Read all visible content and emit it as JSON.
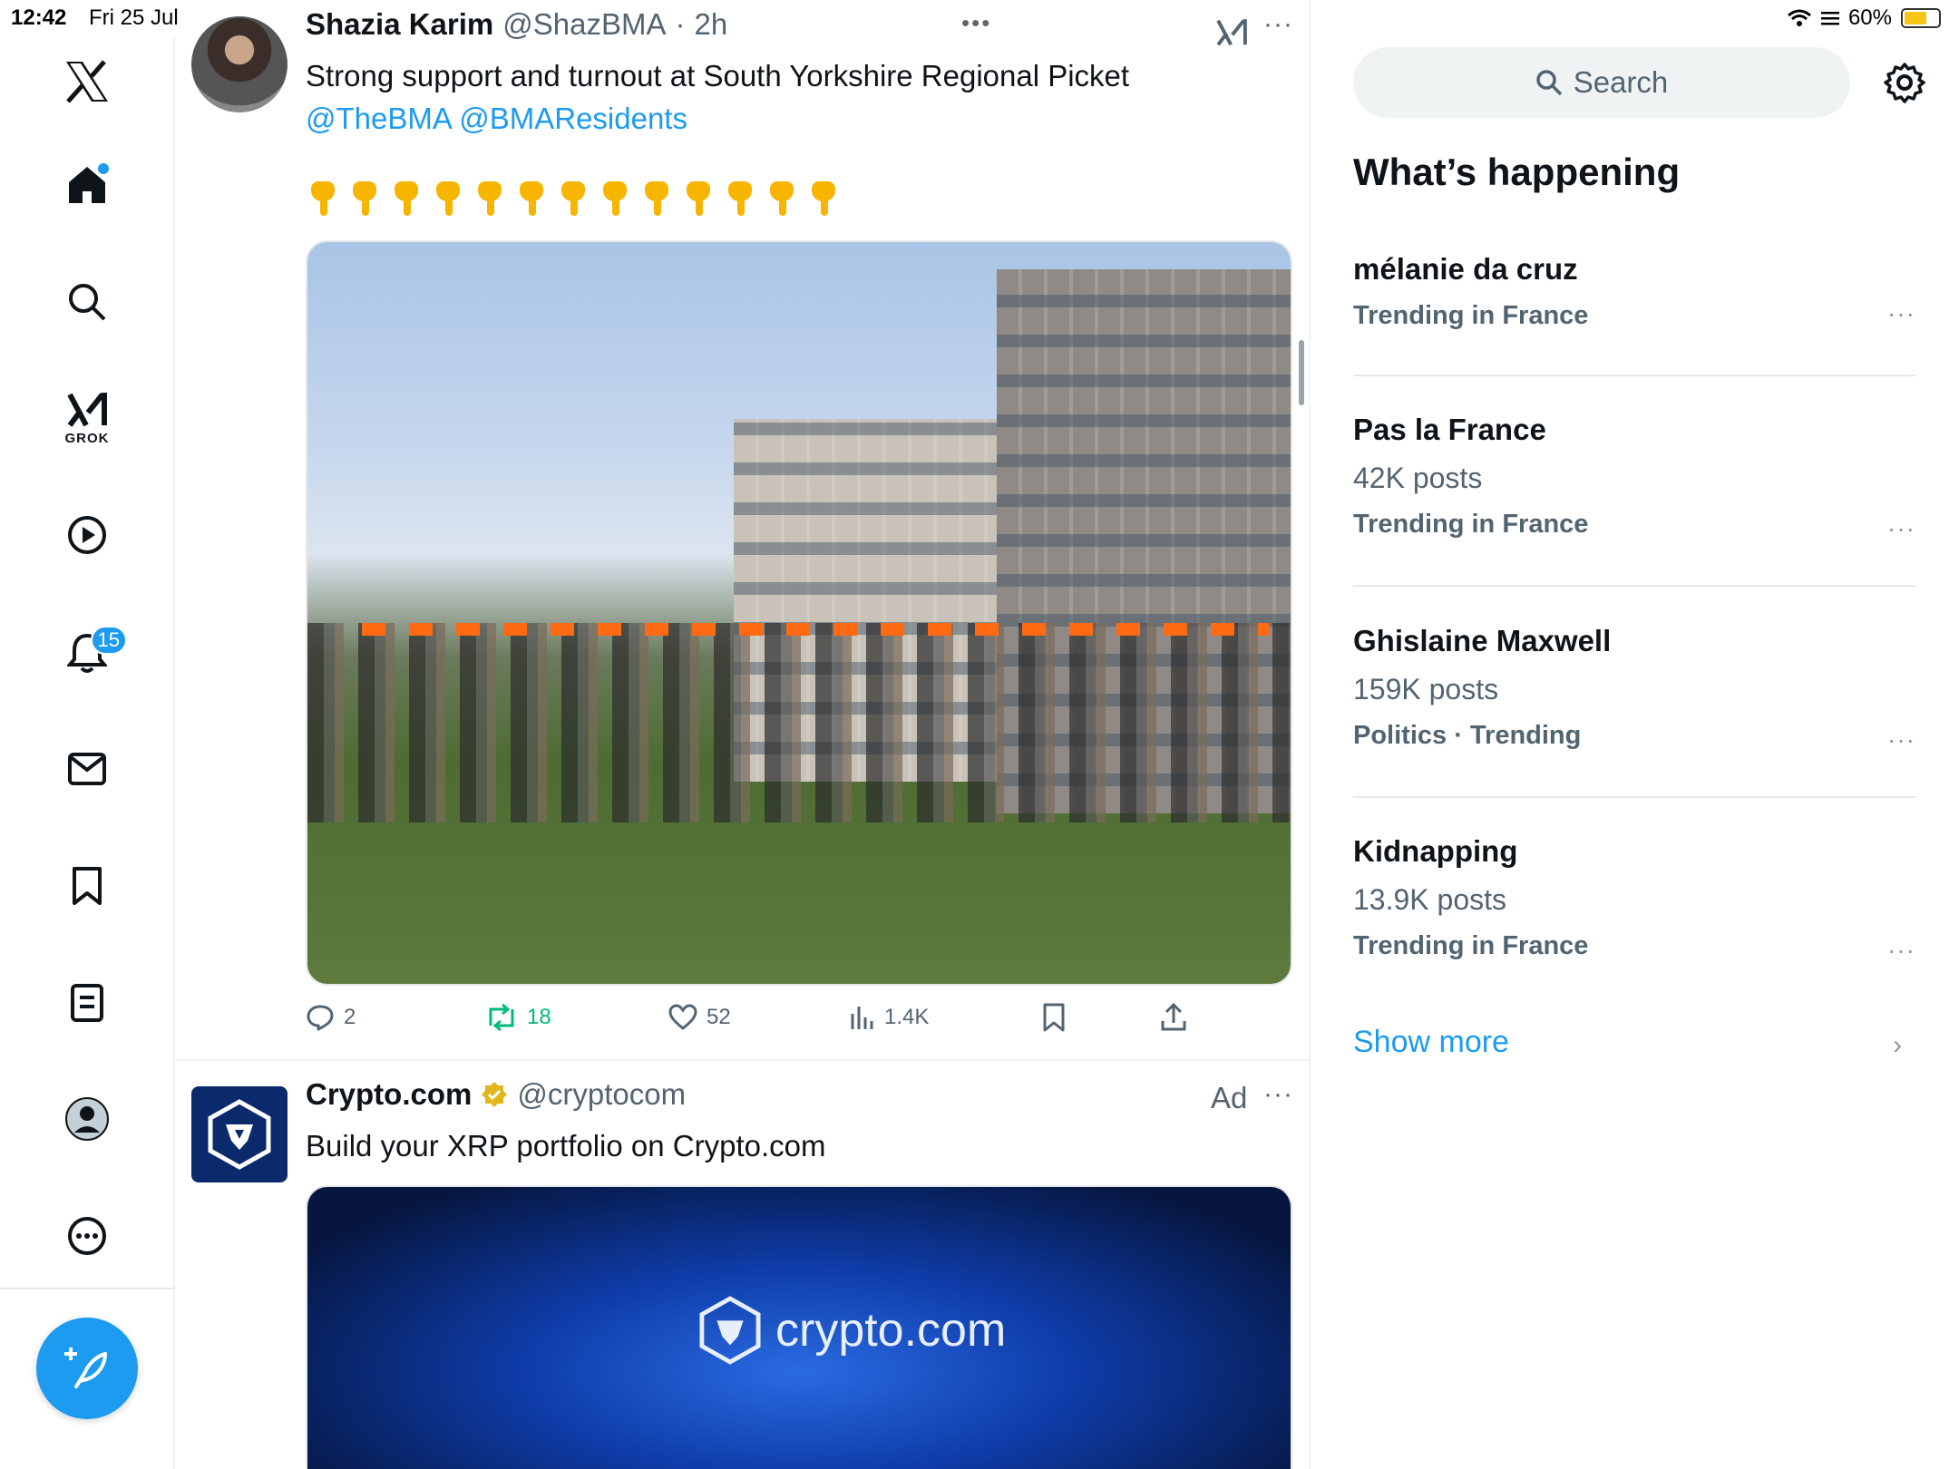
{
  "status_bar": {
    "time": "12:42",
    "date": "Fri 25 Jul",
    "battery": "60%",
    "battery_level": 0.6
  },
  "nav": {
    "grok_label": "GROK",
    "notifications_count": "15"
  },
  "posts": [
    {
      "author": "Shazia Karim",
      "handle": "@ShazBMA",
      "time": "2h",
      "text": "Strong support and turnout at South Yorkshire Regional Picket",
      "mentions": "@TheBMA @BMAResidents",
      "emoji_count": 13,
      "actions": {
        "replies": "2",
        "reposts": "18",
        "likes": "52",
        "views": "1.4K"
      }
    },
    {
      "author": "Crypto.com",
      "handle": "@cryptocom",
      "ad_label": "Ad",
      "text": "Build your XRP portfolio on Crypto.com",
      "media_logo_text": "crypto.com"
    }
  ],
  "right": {
    "search_placeholder": "Search",
    "section_title": "What’s happening",
    "trends": [
      {
        "title": "mélanie da cruz",
        "count": "",
        "context": "Trending in France"
      },
      {
        "title": "Pas la France",
        "count": "42K posts",
        "context": "Trending in France"
      },
      {
        "title": "Ghislaine Maxwell",
        "count": "159K posts",
        "context": "Politics · Trending"
      },
      {
        "title": "Kidnapping",
        "count": "13.9K posts",
        "context": "Trending in France"
      }
    ],
    "show_more": "Show more"
  },
  "colors": {
    "accent": "#1d9bf0",
    "repost": "#00ba7c",
    "text": "#0f1419",
    "muted": "#536471"
  }
}
